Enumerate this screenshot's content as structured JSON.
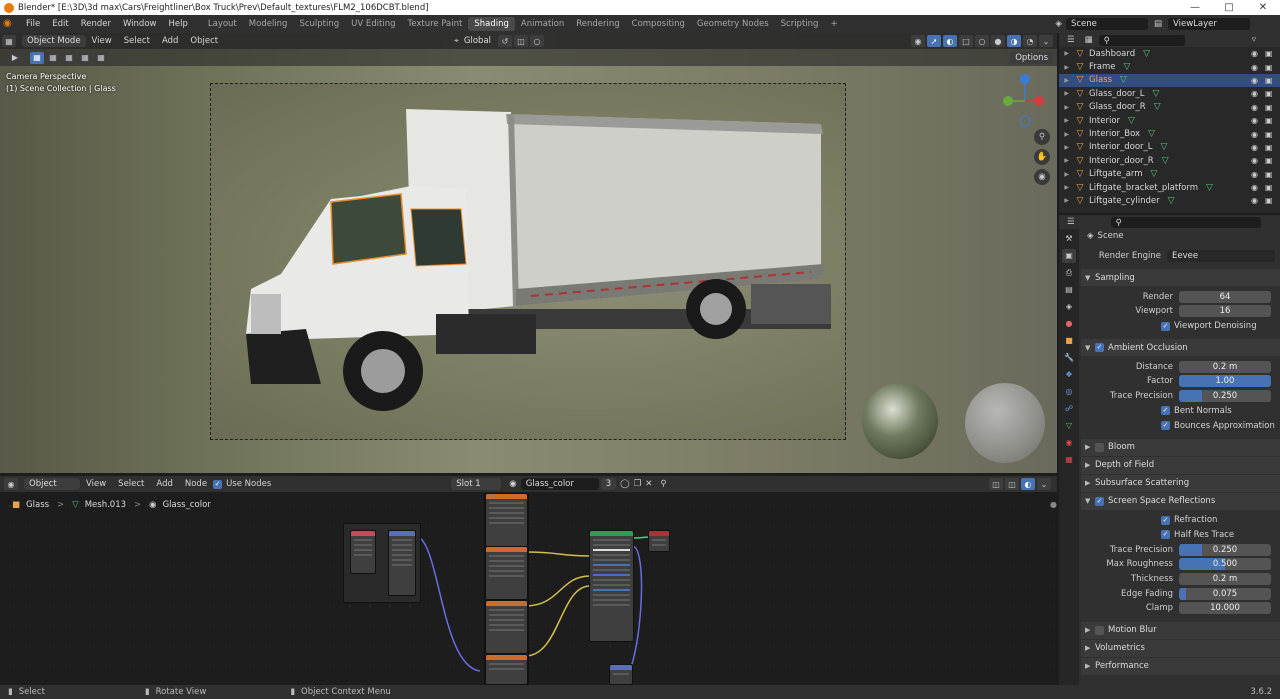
{
  "title": "Blender* [E:\\3D\\3d max\\Cars\\Freightliner\\Box Truck\\Prev\\Default_textures\\FLM2_106DCBT.blend]",
  "menu": [
    "File",
    "Edit",
    "Render",
    "Window",
    "Help"
  ],
  "workspaces": [
    "Layout",
    "Modeling",
    "Sculpting",
    "UV Editing",
    "Texture Paint",
    "Shading",
    "Animation",
    "Rendering",
    "Compositing",
    "Geometry Nodes",
    "Scripting"
  ],
  "active_workspace": "Shading",
  "scene_name": "Scene",
  "view_layer": "ViewLayer",
  "viewport": {
    "mode": "Object Mode",
    "menus": [
      "View",
      "Select",
      "Add",
      "Object"
    ],
    "orientation": "Global",
    "options": "Options",
    "camera_text": "Camera Perspective",
    "collection_text": "(1) Scene Collection | Glass"
  },
  "outliner": {
    "items": [
      {
        "name": "Dashboard",
        "selected": false
      },
      {
        "name": "Frame",
        "selected": false
      },
      {
        "name": "Glass",
        "selected": true
      },
      {
        "name": "Glass_door_L",
        "selected": false
      },
      {
        "name": "Glass_door_R",
        "selected": false
      },
      {
        "name": "Interior",
        "selected": false
      },
      {
        "name": "Interior_Box",
        "selected": false
      },
      {
        "name": "Interior_door_L",
        "selected": false
      },
      {
        "name": "Interior_door_R",
        "selected": false
      },
      {
        "name": "Liftgate_arm",
        "selected": false
      },
      {
        "name": "Liftgate_bracket_platform",
        "selected": false
      },
      {
        "name": "Liftgate_cylinder",
        "selected": false
      }
    ]
  },
  "props": {
    "scene_label": "Scene",
    "render_engine_label": "Render Engine",
    "render_engine": "Eevee",
    "sampling": {
      "title": "Sampling",
      "render_label": "Render",
      "render": "64",
      "viewport_label": "Viewport",
      "viewport": "16",
      "denoise": "Viewport Denoising"
    },
    "ao": {
      "title": "Ambient Occlusion",
      "distance_label": "Distance",
      "distance": "0.2 m",
      "factor_label": "Factor",
      "factor": "1.00",
      "factor_frac": 1.0,
      "trace_label": "Trace Precision",
      "trace": "0.250",
      "trace_frac": 0.25,
      "bent": "Bent Normals",
      "bounces": "Bounces Approximation"
    },
    "bloom": "Bloom",
    "dof": "Depth of Field",
    "sss": "Subsurface Scattering",
    "ssr": {
      "title": "Screen Space Reflections",
      "refraction": "Refraction",
      "halfres": "Half Res Trace",
      "trace_label": "Trace Precision",
      "trace": "0.250",
      "trace_frac": 0.25,
      "rough_label": "Max Roughness",
      "rough": "0.500",
      "rough_frac": 0.5,
      "thick_label": "Thickness",
      "thick": "0.2 m",
      "edge_label": "Edge Fading",
      "edge": "0.075",
      "edge_frac": 0.075,
      "clamp_label": "Clamp",
      "clamp": "10.000"
    },
    "motion": "Motion Blur",
    "volumetrics": "Volumetrics",
    "performance": "Performance"
  },
  "node_editor": {
    "type": "Object",
    "menus": [
      "View",
      "Select",
      "Add",
      "Node"
    ],
    "use_nodes": "Use Nodes",
    "slot": "Slot 1",
    "material": "Glass_color",
    "users": "3",
    "breadcrumb": [
      "Glass",
      "Mesh.013",
      "Glass_color"
    ]
  },
  "status": {
    "select": "Select",
    "rotate": "Rotate View",
    "context": "Object Context Menu",
    "version": "3.6.2"
  },
  "colors": {
    "accent": "#4772b3",
    "selected_row": "#334d80",
    "object_orange": "#e8a34a",
    "mesh_green": "#55c77f"
  }
}
